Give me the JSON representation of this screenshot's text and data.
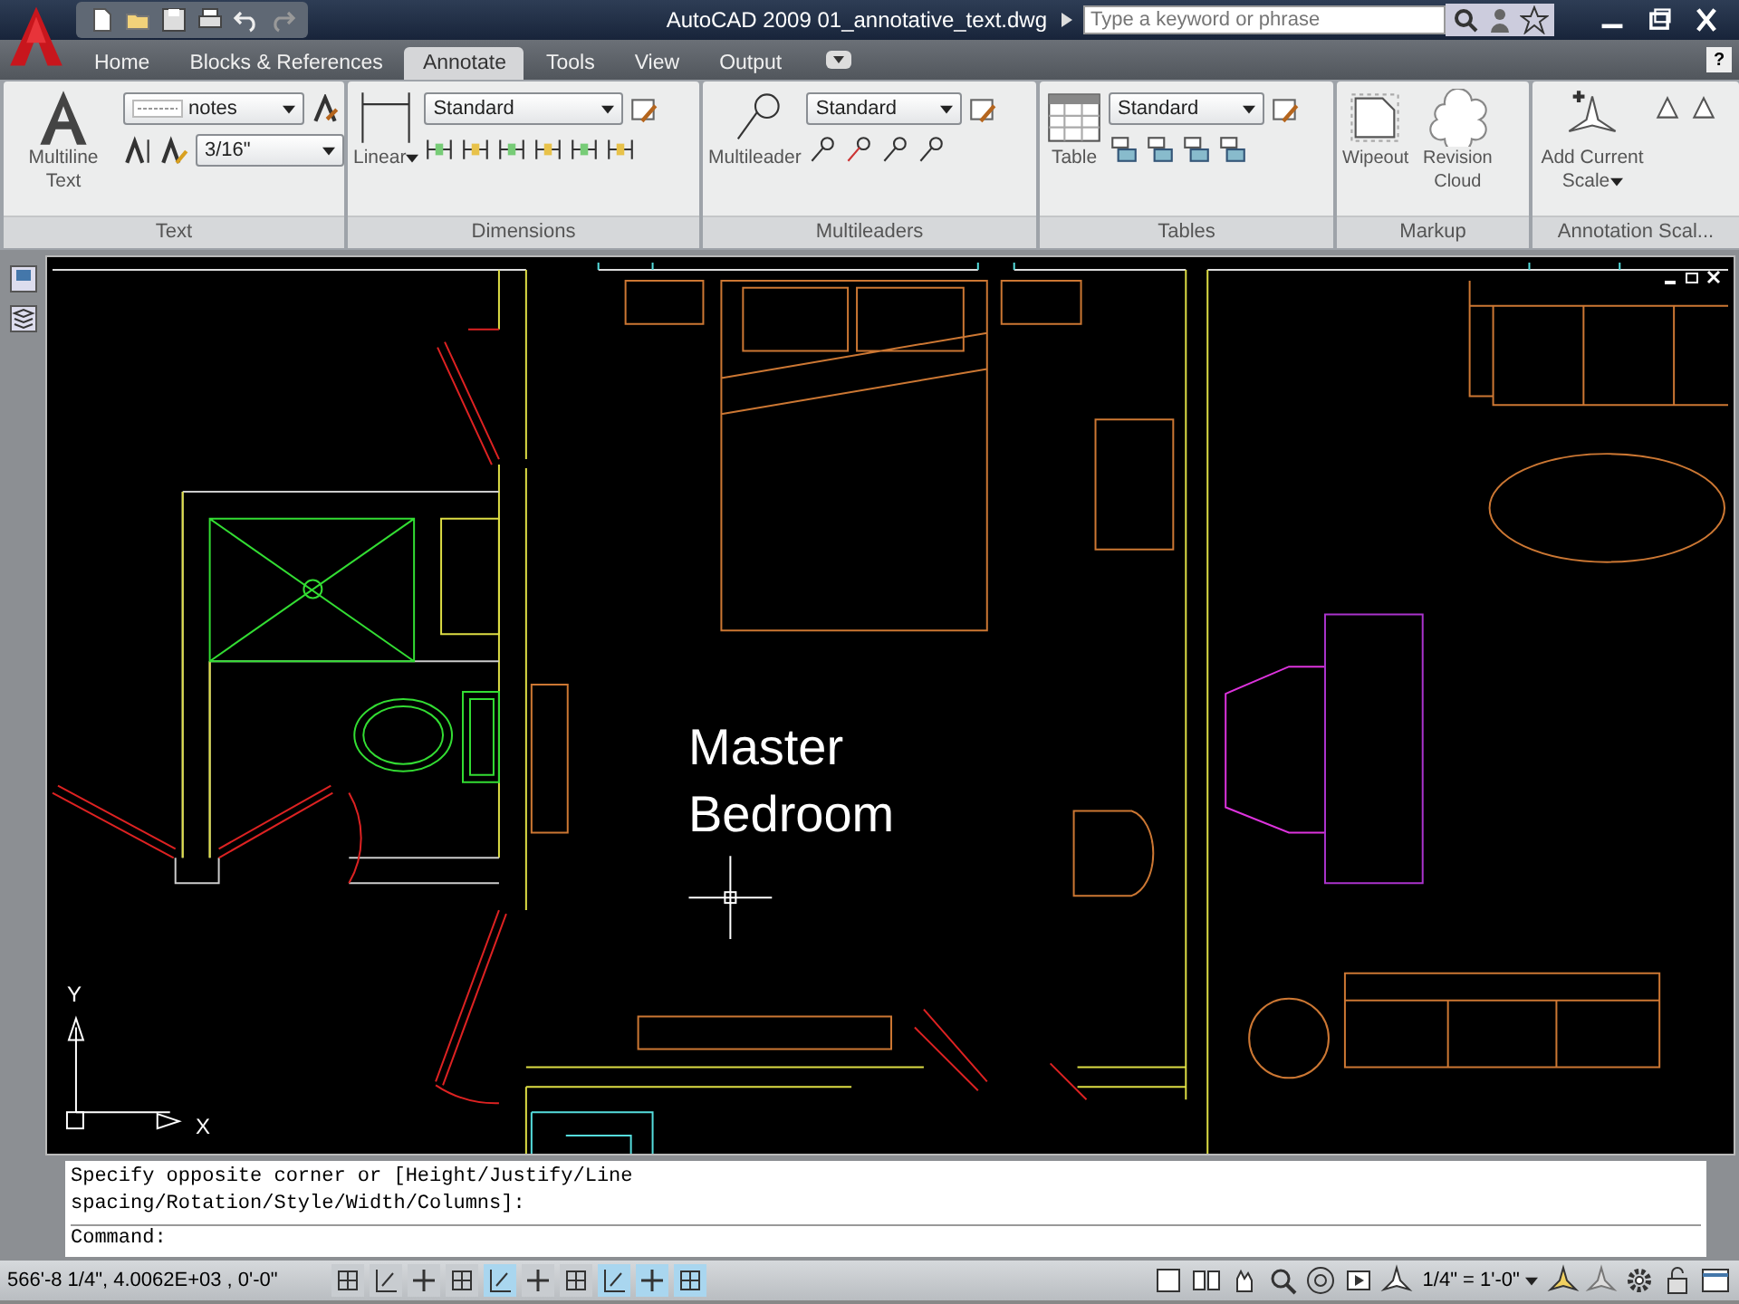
{
  "title_bar": {
    "app": "AutoCAD 2009",
    "file": "01_annotative_text.dwg",
    "search": {
      "placeholder": "Type a keyword or phrase"
    }
  },
  "ribbon": {
    "tabs": [
      {
        "label": "Home",
        "selected": false
      },
      {
        "label": "Blocks & References",
        "selected": false
      },
      {
        "label": "Annotate",
        "selected": true
      },
      {
        "label": "Tools",
        "selected": false
      },
      {
        "label": "View",
        "selected": false
      },
      {
        "label": "Output",
        "selected": false
      }
    ],
    "help": "?",
    "panels": [
      {
        "kind": "text",
        "title": "Text",
        "large_button": "Multiline Text",
        "style_value": "notes",
        "height_value": "3/16\""
      },
      {
        "kind": "dimensions",
        "title": "Dimensions",
        "large_button": "Linear",
        "style_value": "Standard"
      },
      {
        "kind": "multileaders",
        "title": "Multileaders",
        "large_button": "Multileader",
        "style_value": "Standard"
      },
      {
        "kind": "tables",
        "title": "Tables",
        "large_button": "Table",
        "style_value": "Standard"
      },
      {
        "kind": "markup",
        "title": "Markup",
        "buttons": [
          "Wipeout",
          "Revision Cloud"
        ]
      },
      {
        "kind": "annotation_scaling",
        "title": "Annotation Scal...",
        "large_button": "Add Current Scale"
      }
    ]
  },
  "drawing": {
    "room_label": "Master Bedroom",
    "ucs_x": "X",
    "ucs_y": "Y"
  },
  "command_line": {
    "history": [
      "Specify opposite corner or [Height/Justify/Line",
      "spacing/Rotation/Style/Width/Columns]:"
    ],
    "prompt": "Command:"
  },
  "status_bar": {
    "coordinates": "566'-8 1/4\", 4.0062E+03 , 0'-0\"",
    "toggles": [
      {
        "on": false
      },
      {
        "on": false
      },
      {
        "on": false
      },
      {
        "on": false
      },
      {
        "on": true
      },
      {
        "on": false
      },
      {
        "on": false
      },
      {
        "on": true
      },
      {
        "on": true
      },
      {
        "on": true
      }
    ],
    "annotation_scale": "1/4\" = 1'-0\""
  }
}
